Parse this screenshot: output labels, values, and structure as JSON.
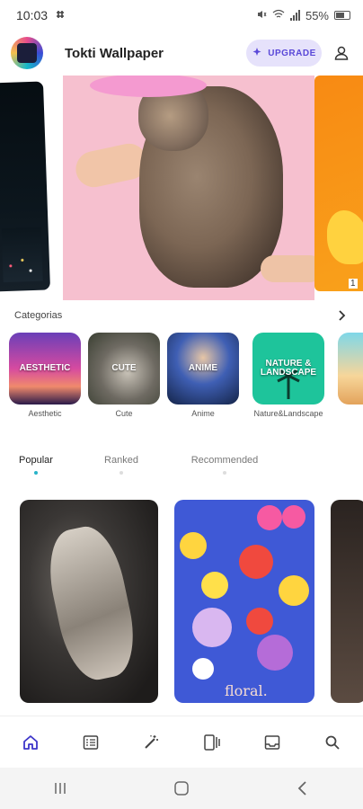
{
  "status": {
    "time": "10:03",
    "battery": "55%"
  },
  "header": {
    "title": "Tokti Wallpaper",
    "upgrade_label": "UPGRADE"
  },
  "carousel": {
    "indicator": "1"
  },
  "categories": {
    "title": "Categorias",
    "items": [
      {
        "label": "Aesthetic",
        "thumb_text": "AESTHETIC",
        "color": "#d64aa0"
      },
      {
        "label": "Cute",
        "thumb_text": "CUTE",
        "color": "#8f8f86"
      },
      {
        "label": "Anime",
        "thumb_text": "ANIME",
        "color": "#3f5fb4"
      },
      {
        "label": "Nature&Landscape",
        "thumb_text": "NATURE & LANDSCAPE",
        "color": "#1ec49b"
      }
    ]
  },
  "tabs": {
    "items": [
      "Popular",
      "Ranked",
      "Recommended"
    ],
    "active": "Popular"
  },
  "wallpapers": {
    "floral_text": "floral."
  },
  "colors": {
    "accent": "#5a48d8",
    "tab_indicator": "#28b3c8",
    "nav_active": "#3d35c9"
  }
}
